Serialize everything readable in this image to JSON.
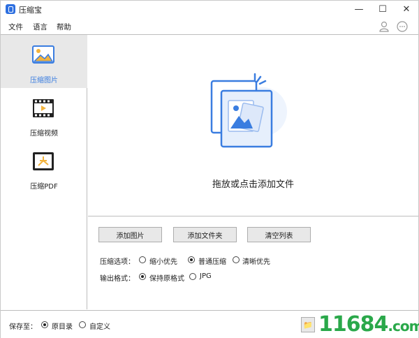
{
  "window": {
    "title": "压缩宝",
    "minimize": "—",
    "maximize": "☐",
    "close": "✕"
  },
  "menu": {
    "file": "文件",
    "language": "语言",
    "help": "帮助"
  },
  "sidebar": {
    "items": [
      {
        "label": "压缩图片",
        "icon": "image-icon"
      },
      {
        "label": "压缩视频",
        "icon": "film-icon"
      },
      {
        "label": "压缩PDF",
        "icon": "pdf-icon"
      }
    ]
  },
  "drop_area": {
    "text": "拖放或点击添加文件"
  },
  "actions": {
    "add_images": "添加图片",
    "add_folder": "添加文件夹",
    "clear_list": "清空列表"
  },
  "compress": {
    "label": "压缩选项：",
    "options": [
      "缩小优先",
      "普通压缩",
      "清晰优先"
    ],
    "selected": "普通压缩"
  },
  "output": {
    "label": "输出格式：",
    "options": [
      "保持原格式",
      "JPG"
    ],
    "selected": "保持原格式"
  },
  "save": {
    "label": "保存至：",
    "options": [
      "原目录",
      "自定义"
    ],
    "selected": "原目录"
  },
  "watermark": {
    "number": "11684",
    "domain": ".com"
  },
  "colors": {
    "accent": "#3a7de0",
    "watermark": "#2aa84a"
  }
}
